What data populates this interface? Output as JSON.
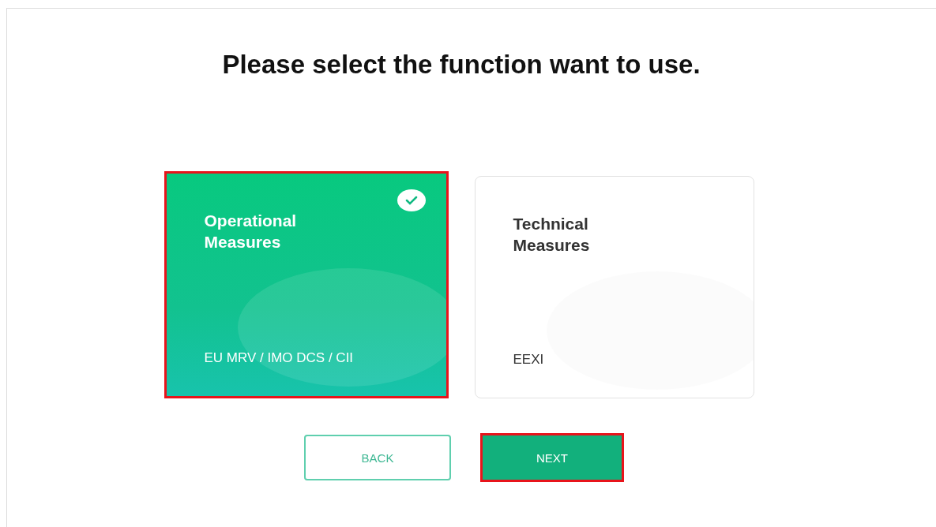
{
  "heading": "Please select the function want to use.",
  "options": [
    {
      "title": "Operational Measures",
      "subtitle": "EU MRV / IMO DCS / CII",
      "selected": true,
      "highlighted": true
    },
    {
      "title": "Technical Measures",
      "subtitle": "EEXI",
      "selected": false,
      "highlighted": false
    }
  ],
  "buttons": [
    {
      "label": "BACK",
      "kind": "outline",
      "highlighted": false
    },
    {
      "label": "NEXT",
      "kind": "primary",
      "highlighted": true
    }
  ]
}
